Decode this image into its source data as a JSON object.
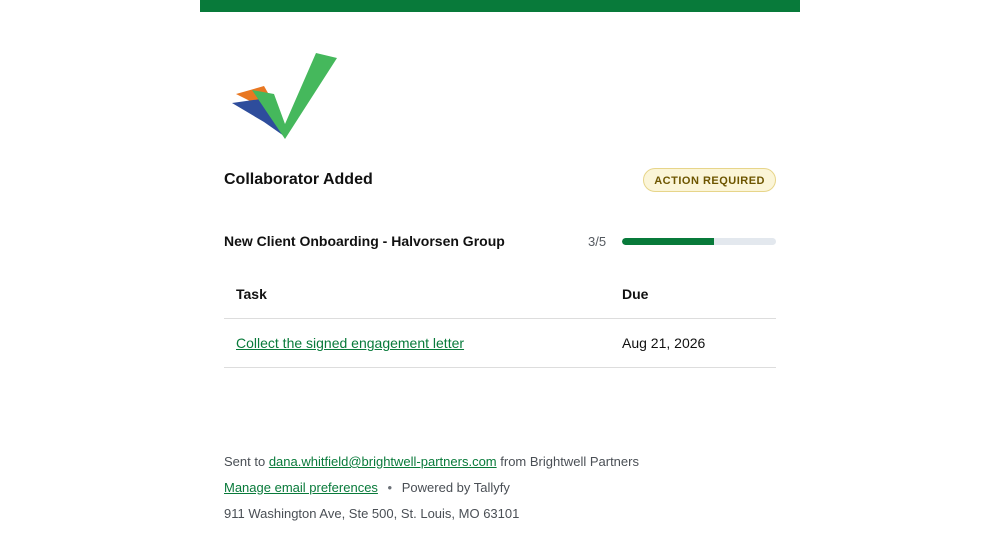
{
  "header": {
    "accent_color": "#087a3a"
  },
  "logo": {
    "icon": "checkmark-logo-icon"
  },
  "notification": {
    "title": "Collaborator Added",
    "badge": "ACTION REQUIRED"
  },
  "process": {
    "name": "New Client Onboarding - Halvorsen Group",
    "progress_label": "3/5",
    "progress_fraction": 0.6
  },
  "table": {
    "headers": [
      "Task",
      "Due"
    ],
    "rows": [
      {
        "task": "Collect the signed engagement letter",
        "due": "Aug 21, 2026"
      }
    ]
  },
  "footer": {
    "sent_to_prefix": "Sent to",
    "email": "dana.whitfield@brightwell-partners.com",
    "from_text": "from Brightwell Partners",
    "manage_link": "Manage email preferences",
    "separator": "•",
    "powered_by": "Powered by Tallyfy",
    "address": "911 Washington Ave, Ste 500, St. Louis, MO 63101"
  }
}
